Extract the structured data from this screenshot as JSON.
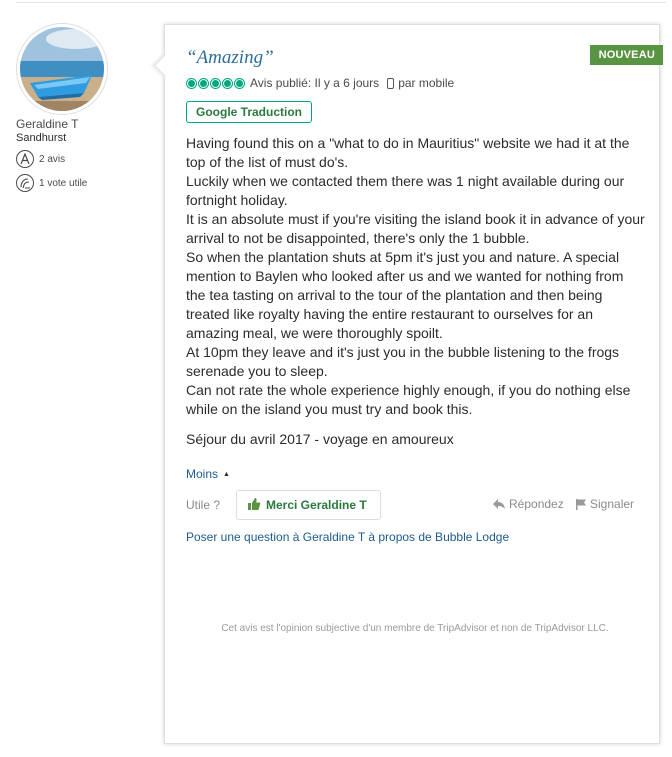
{
  "member": {
    "name": "Geraldine T",
    "location": "Sandhurst",
    "reviews": "2 avis",
    "helpful": "1 vote utile"
  },
  "review": {
    "badge": "NOUVEAU",
    "title": "“Amazing”",
    "rating": 5,
    "published": "Avis publié: Il y a 6 jours",
    "via": "par mobile",
    "translate_label": "Google Traduction",
    "paragraphs": [
      "Having found this on a \"what to do in Mauritius\" website we had it at the top of the list of must do's.",
      "Luckily when we contacted them there was 1 night available during our fortnight holiday.",
      "It is an absolute must if you're visiting the island book it in advance of your arrival to not be disappointed, there's only the 1 bubble.",
      "So when the plantation shuts at 5pm it's just you and nature. A special mention to Baylen who looked after us and we wanted for nothing from the tea tasting on arrival to the tour of the plantation and then being treated like royalty having the entire restaurant to ourselves for an amazing meal, we were thoroughly spoilt.",
      "At 10pm they leave and it's just you in the bubble listening to the frogs serenade you to sleep.",
      "Can not rate the whole experience highly enough, if you do nothing else while on the island you must try and book this."
    ],
    "stay": "Séjour du avril 2017 - voyage en amoureux",
    "less_label": "Moins",
    "useful_label": "Utile ?",
    "thanks_label": "Merci Geraldine T",
    "reply_label": "Répondez",
    "report_label": "Signaler",
    "ask_link": "Poser une question à Geraldine T à propos de Bubble Lodge",
    "disclaimer": "Cet avis est l'opinion subjective d'un membre de TripAdvisor et non de TripAdvisor LLC."
  },
  "icons": {
    "reviews": "review-badge-icon",
    "helpful": "helpful-vote-icon",
    "mobile": "mobile-phone-icon",
    "thumb": "thumbs-up-icon",
    "reply": "reply-arrow-icon",
    "report": "flag-icon"
  },
  "colors": {
    "new_badge": "#589442",
    "bubble_rating": "#00a680",
    "link": "#1e5c8c",
    "title": "#2e6e99",
    "thanks": "#2b7a3d"
  }
}
